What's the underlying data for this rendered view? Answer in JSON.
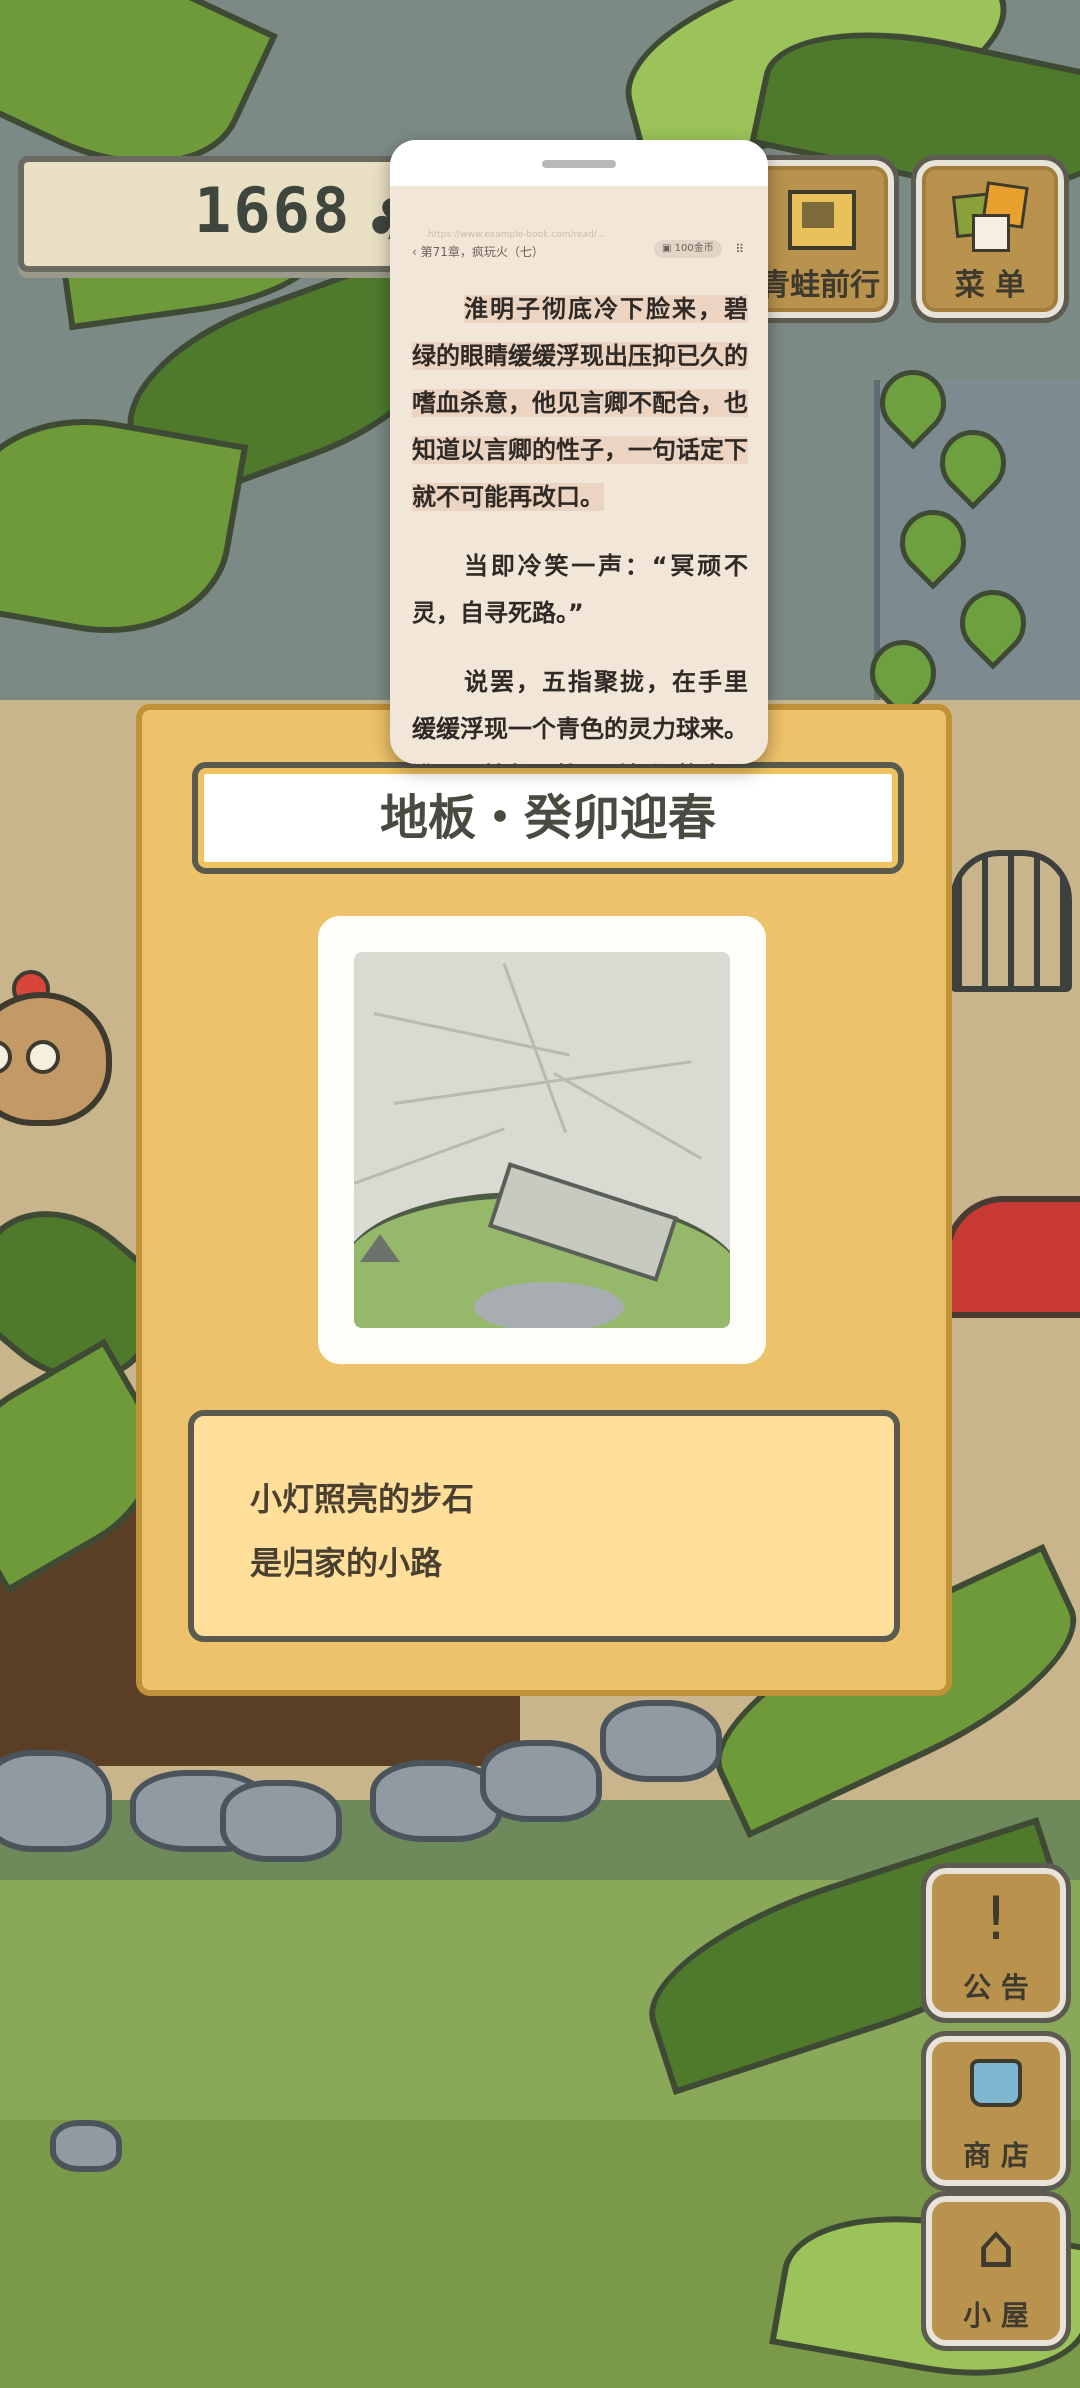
{
  "clover_counter": {
    "value": "1668",
    "icon": "clover-icon"
  },
  "top_buttons": {
    "frog_travel": {
      "label": "青蛙前行",
      "icon": "map-icon"
    },
    "menu": {
      "label": "菜 单",
      "icon": "menu-icon"
    }
  },
  "reader": {
    "url": "https://www.example-book.com/read/...",
    "chapter": "第71章，疯玩火（七）",
    "coins": "100金币",
    "more_icon": "more-icon",
    "paragraphs": [
      "淮明子彻底冷下脸来，碧绿的眼睛缓缓浮现出压抑已久的嗜血杀意，他见言卿不配合，也知道以言卿的性子，一句话定下就不可能再改口。",
      "当即冷笑一声：“冥顽不灵，自寻死路。”",
      "说罢，五指聚拢，在手里缓缓浮现一个青色的灵力球来。淮明子擦长而笑，手捏间的金"
    ]
  },
  "item_card": {
    "title": "地板・癸卯迎春",
    "description": [
      "小灯照亮的步石",
      "是归家的小路"
    ]
  },
  "side_buttons": [
    {
      "label": "公 告",
      "icon": "exclamation-icon"
    },
    {
      "label": "商 店",
      "icon": "shop-bag-icon"
    },
    {
      "label": "小 屋",
      "icon": "house-icon"
    }
  ],
  "colors": {
    "card_bg": "#ecc26a",
    "card_border": "#bf9138",
    "button_wood": "#b9924e",
    "reader_bg": "#f1e6d7",
    "highlight": "#ecd4c2"
  }
}
